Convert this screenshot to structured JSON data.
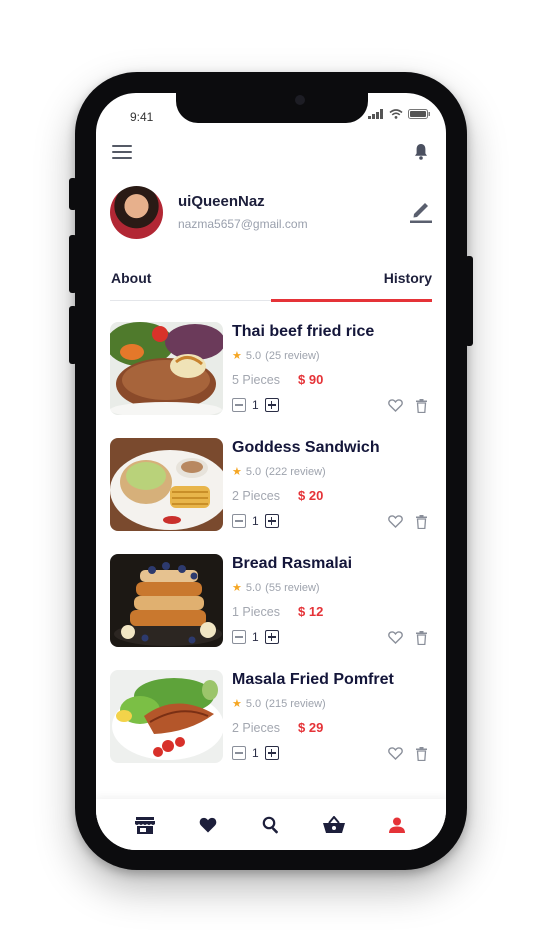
{
  "status_bar": {
    "time": "9:41"
  },
  "profile": {
    "name": "uiQueenNaz",
    "email": "nazma5657@gmail.com"
  },
  "tabs": [
    {
      "label": "About",
      "active": false
    },
    {
      "label": "History",
      "active": true
    }
  ],
  "orders": [
    {
      "title": "Thai beef fried rice",
      "rating": "5.0",
      "reviews": "(25 review)",
      "pieces": "5 Pieces",
      "price": "$ 90",
      "quantity": "1"
    },
    {
      "title": "Goddess Sandwich",
      "rating": "5.0",
      "reviews": "(222 review)",
      "pieces": "2 Pieces",
      "price": "$ 20",
      "quantity": "1"
    },
    {
      "title": "Bread Rasmalai",
      "rating": "5.0",
      "reviews": "(55 review)",
      "pieces": "1 Pieces",
      "price": "$ 12",
      "quantity": "1"
    },
    {
      "title": "Masala Fried Pomfret",
      "rating": "5.0",
      "reviews": "(215 review)",
      "pieces": "2 Pieces",
      "price": "$ 29",
      "quantity": "1"
    }
  ],
  "bottom_nav": [
    {
      "icon": "store-icon",
      "active": false
    },
    {
      "icon": "heart-icon",
      "active": false
    },
    {
      "icon": "search-icon",
      "active": false
    },
    {
      "icon": "basket-icon",
      "active": false
    },
    {
      "icon": "profile-icon",
      "active": true
    }
  ],
  "colors": {
    "accent": "#e53338",
    "text_dark": "#1d1f3b",
    "text_muted": "#9ea3ad",
    "star": "#f5a623"
  }
}
